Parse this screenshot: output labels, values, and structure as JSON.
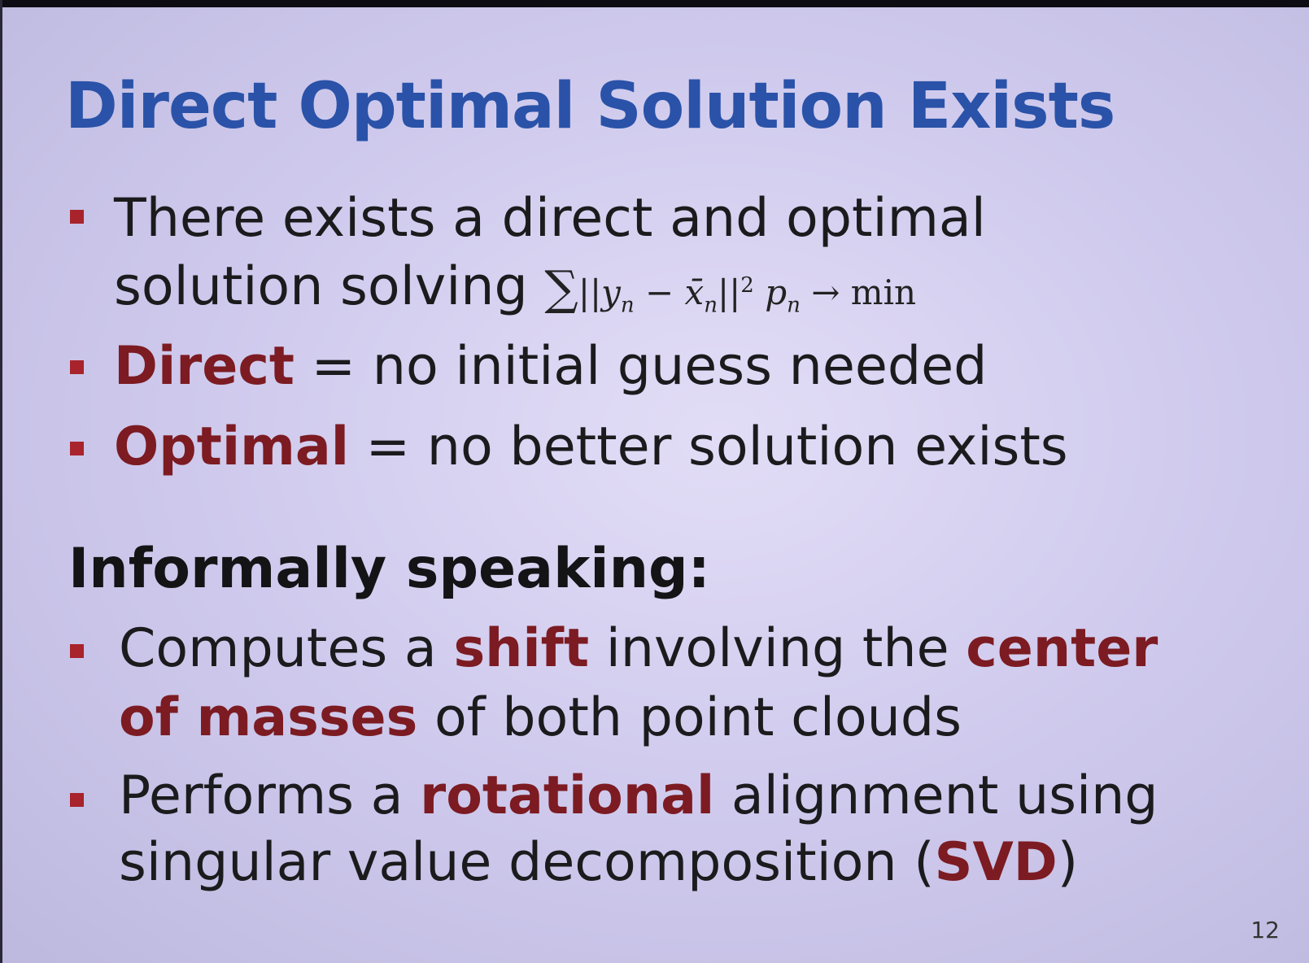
{
  "slide": {
    "title": "Direct Optimal Solution Exists",
    "bullets_top": [
      {
        "line1": "There exists a direct and optimal",
        "line2_text": "solution solving",
        "formula": {
          "sum": "∑",
          "norm_open": "||",
          "y": "y",
          "y_sub": "n",
          "minus": "−",
          "x": "x̄",
          "x_sub": "n",
          "norm_close": "||",
          "power": "2",
          "p": "p",
          "p_sub": "n",
          "arrow": "→",
          "min": "min"
        }
      },
      {
        "term": "Direct",
        "rest": " = no initial guess needed"
      },
      {
        "term": "Optimal",
        "rest": " = no better solution exists"
      }
    ],
    "heading": "Informally speaking:",
    "bullets_bottom": [
      {
        "t1": "Computes a ",
        "k1": "shift",
        "t2": " involving the ",
        "k2": "center",
        "k3": "of masses",
        "t3": " of both point clouds"
      },
      {
        "t1": "Performs a ",
        "k1": "rotational",
        "t2": " alignment using",
        "t3": "singular value decomposition (",
        "k2": "SVD",
        "t4": ")"
      }
    ],
    "page_number": "12"
  },
  "colors": {
    "title": "#2a52a8",
    "keyword": "#7c1b22",
    "bullet": "#a8232b",
    "text": "#1b1b1d",
    "background": "#cfcaed"
  }
}
